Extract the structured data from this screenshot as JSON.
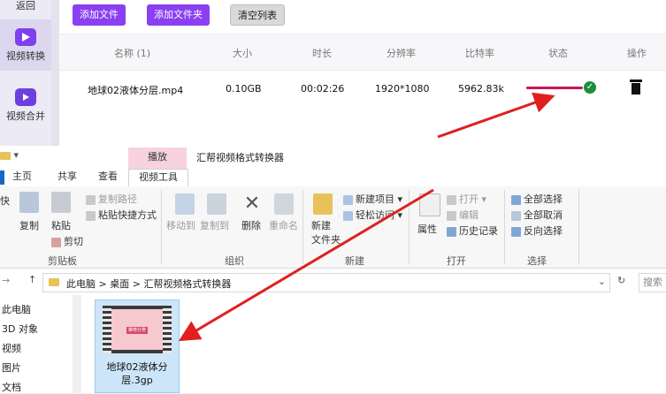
{
  "sidebar": {
    "back": "返回",
    "items": [
      {
        "label": "视频转换",
        "icon": "video-convert-icon"
      },
      {
        "label": "视频合并",
        "icon": "video-merge-icon"
      }
    ]
  },
  "toolbar": {
    "add_file": "添加文件",
    "add_folder": "添加文件夹",
    "clear_list": "清空列表"
  },
  "table": {
    "headers": [
      "名称 (1)",
      "大小",
      "时长",
      "分辨率",
      "比特率",
      "状态",
      "操作"
    ],
    "row": {
      "name": "地球02液体分层.mp4",
      "size": "0.10GB",
      "duration": "00:02:26",
      "resolution": "1920*1080",
      "bitrate": "5962.83k"
    }
  },
  "explorer": {
    "quick_access": "▾",
    "context_tab": "播放",
    "title": "汇帮视频格式转换器",
    "tabs": [
      "主页",
      "共享",
      "查看",
      "视频工具"
    ],
    "ribbon": {
      "clipboard": {
        "label": "剪贴板",
        "pin": "快",
        "copy": "复制",
        "paste": "粘贴",
        "copy_path": "复制路径",
        "paste_shortcut": "粘贴快捷方式",
        "cut": "剪切"
      },
      "organize": {
        "label": "组织",
        "move_to": "移动到",
        "copy_to": "复制到",
        "delete": "删除",
        "rename": "重命名"
      },
      "new": {
        "label": "新建",
        "new_folder": "新建",
        "new_folder2": "文件夹",
        "new_item": "新建项目",
        "easy_access": "轻松访问"
      },
      "open": {
        "label": "打开",
        "properties": "属性",
        "open": "打开",
        "edit": "编辑",
        "history": "历史记录"
      },
      "select": {
        "label": "选择",
        "select_all": "全部选择",
        "select_none": "全部取消",
        "invert": "反向选择"
      }
    },
    "address": {
      "parts": [
        "此电脑",
        "桌面",
        "汇帮视频格式转换器"
      ],
      "search": "搜索"
    },
    "nav": [
      "此电脑",
      "3D 对象",
      "视频",
      "图片",
      "文档"
    ],
    "file": {
      "name": "地球02液体分层.3gp",
      "thumb_text": "推荐分类"
    }
  }
}
